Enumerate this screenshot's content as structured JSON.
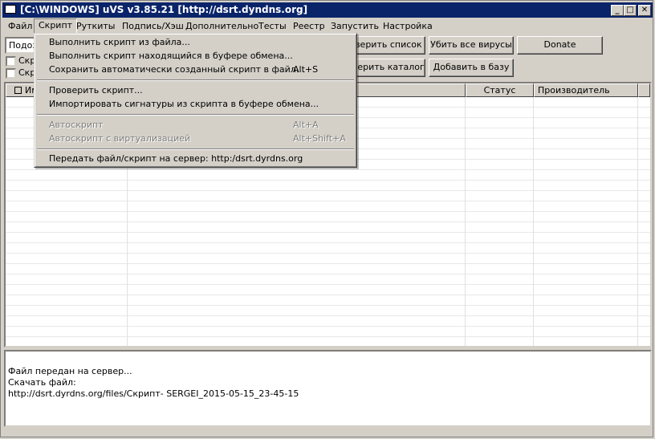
{
  "window": {
    "title": "[C:\\WINDOWS] uVS v3.85.21 [http://dsrt.dyndns.org]"
  },
  "title_buttons": {
    "minimize": "_",
    "maximize": "□",
    "close": "✕"
  },
  "menubar": {
    "items": [
      "Файл",
      "Скрипт",
      "Руткиты",
      "Подпись/Хэш",
      "Дополнительно",
      "Тесты",
      "Реестр",
      "Запустить",
      "Настройка"
    ]
  },
  "toolbar": {
    "combo_value": "Подозр",
    "checkbox1_label": "Скр",
    "checkbox2_label": "Скр",
    "check_list_button": "оверить список",
    "kill_viruses_button": "Убить все вирусы",
    "donate_button": "Donate",
    "check_catalog_button": "оверить каталог",
    "add_to_db_button": "Добавить в базу"
  },
  "list": {
    "col_name": "Им",
    "col_status": "Статус",
    "col_vendor": "Производитель"
  },
  "script_menu": {
    "items": [
      {
        "label": "Выполнить скрипт из файла...",
        "shortcut": ""
      },
      {
        "label": "Выполнить скрипт находящийся в буфере обмена...",
        "shortcut": ""
      },
      {
        "label": "Сохранить автоматически созданный скрипт в файл...",
        "shortcut": "Alt+S"
      },
      {
        "label": "Проверить скрипт...",
        "shortcut": ""
      },
      {
        "label": "Импортировать сигнатуры из скрипта в буфере обмена...",
        "shortcut": ""
      },
      {
        "label": "Автоскрипт",
        "shortcut": "Alt+A",
        "disabled": true
      },
      {
        "label": "Автоскрипт с виртуализацией",
        "shortcut": "Alt+Shift+A",
        "disabled": true
      },
      {
        "label": "Передать файл/скрипт на сервер: http:/dsrt.dyrdns.org",
        "shortcut": ""
      }
    ]
  },
  "log": {
    "lines": [
      "Файл передан на сервер...",
      "Скачать файл:",
      "http://dsrt.dyrdns.org/files/Скрипт- SERGEI_2015-05-15_23-45-15"
    ]
  }
}
